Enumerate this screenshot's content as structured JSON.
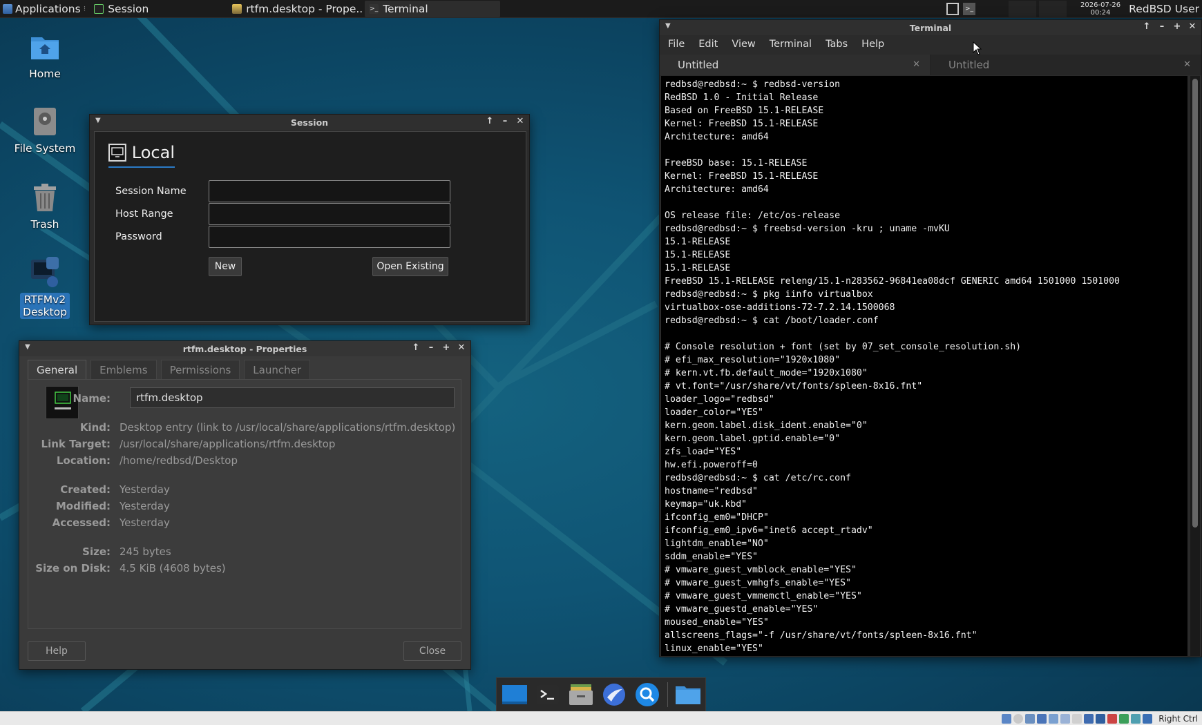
{
  "top_panel": {
    "applications_label": "Applications",
    "tasks": [
      {
        "label": "Session",
        "icon": "monitor-icon"
      },
      {
        "label": "rtfm.desktop - Prope...",
        "icon": "file-properties-icon"
      },
      {
        "label": "Terminal",
        "icon": "terminal-icon"
      }
    ],
    "clock_date": "2026-07-26",
    "clock_time": "00:24",
    "user": "RedBSD User"
  },
  "desktop": {
    "icons": [
      {
        "label": "Home",
        "icon": "home-folder-icon"
      },
      {
        "label": "File System",
        "icon": "drive-icon"
      },
      {
        "label": "Trash",
        "icon": "trash-icon"
      },
      {
        "label": "RTFMv2 Desktop",
        "label_line1": "RTFMv2",
        "label_line2": "Desktop",
        "icon": "rtfm-icon"
      }
    ]
  },
  "session_window": {
    "title": "Session",
    "tab_label": "Local",
    "fields": [
      {
        "label": "Session Name",
        "value": ""
      },
      {
        "label": "Host Range",
        "value": ""
      },
      {
        "label": "Password",
        "value": ""
      }
    ],
    "new_button": "New",
    "open_button": "Open Existing"
  },
  "properties_window": {
    "title": "rtfm.desktop - Properties",
    "tabs": [
      "General",
      "Emblems",
      "Permissions",
      "Launcher"
    ],
    "active_tab": "General",
    "name_label": "Name:",
    "name_value": "rtfm.desktop",
    "rows": [
      {
        "k": "Kind:",
        "v": "Desktop entry (link to /usr/local/share/applications/rtfm.desktop)"
      },
      {
        "k": "Link Target:",
        "v": "/usr/local/share/applications/rtfm.desktop"
      },
      {
        "k": "Location:",
        "v": "/home/redbsd/Desktop"
      },
      {
        "k": "Created:",
        "v": "Yesterday"
      },
      {
        "k": "Modified:",
        "v": "Yesterday"
      },
      {
        "k": "Accessed:",
        "v": "Yesterday"
      },
      {
        "k": "Size:",
        "v": "245 bytes"
      },
      {
        "k": "Size on Disk:",
        "v": "4.5 KiB (4608 bytes)"
      }
    ],
    "help_button": "Help",
    "close_button": "Close"
  },
  "terminal_window": {
    "title": "Terminal",
    "menu": [
      "File",
      "Edit",
      "View",
      "Terminal",
      "Tabs",
      "Help"
    ],
    "tabs": [
      {
        "label": "Untitled",
        "active": true
      },
      {
        "label": "Untitled",
        "active": false
      }
    ],
    "lines": [
      "redbsd@redbsd:~ $ redbsd-version",
      "RedBSD 1.0 - Initial Release",
      "Based on FreeBSD 15.1-RELEASE",
      "Kernel: FreeBSD 15.1-RELEASE",
      "Architecture: amd64",
      "",
      "FreeBSD base: 15.1-RELEASE",
      "Kernel: FreeBSD 15.1-RELEASE",
      "Architecture: amd64",
      "",
      "OS release file: /etc/os-release",
      "redbsd@redbsd:~ $ freebsd-version -kru ; uname -mvKU",
      "15.1-RELEASE",
      "15.1-RELEASE",
      "15.1-RELEASE",
      "FreeBSD 15.1-RELEASE releng/15.1-n283562-96841ea08dcf GENERIC amd64 1501000 1501000",
      "redbsd@redbsd:~ $ pkg iinfo virtualbox",
      "virtualbox-ose-additions-72-7.2.14.1500068",
      "redbsd@redbsd:~ $ cat /boot/loader.conf",
      "",
      "# Console resolution + font (set by 07_set_console_resolution.sh)",
      "# efi_max_resolution=\"1920x1080\"",
      "# kern.vt.fb.default_mode=\"1920x1080\"",
      "# vt.font=\"/usr/share/vt/fonts/spleen-8x16.fnt\"",
      "loader_logo=\"redbsd\"",
      "loader_color=\"YES\"",
      "kern.geom.label.disk_ident.enable=\"0\"",
      "kern.geom.label.gptid.enable=\"0\"",
      "zfs_load=\"YES\"",
      "hw.efi.poweroff=0",
      "redbsd@redbsd:~ $ cat /etc/rc.conf",
      "hostname=\"redbsd\"",
      "keymap=\"uk.kbd\"",
      "ifconfig_em0=\"DHCP\"",
      "ifconfig_em0_ipv6=\"inet6 accept_rtadv\"",
      "lightdm_enable=\"NO\"",
      "sddm_enable=\"YES\"",
      "# vmware_guest_vmblock_enable=\"YES\"",
      "# vmware_guest_vmhgfs_enable=\"YES\"",
      "# vmware_guest_vmmemctl_enable=\"YES\"",
      "# vmware_guestd_enable=\"YES\"",
      "moused_enable=\"YES\"",
      "allscreens_flags=\"-f /usr/share/vt/fonts/spleen-8x16.fnt\"",
      "linux_enable=\"YES\""
    ]
  },
  "dock": {
    "items": [
      "desktop-icon",
      "terminal-icon",
      "file-manager-icon",
      "web-browser-icon",
      "search-icon",
      "folder-icon"
    ]
  },
  "status_bar": {
    "host_key": "Right Ctrl"
  },
  "colors": {
    "accent": "#2b7bc7",
    "terminal_bg": "#000000",
    "panel_bg": "#1b1b1b"
  }
}
